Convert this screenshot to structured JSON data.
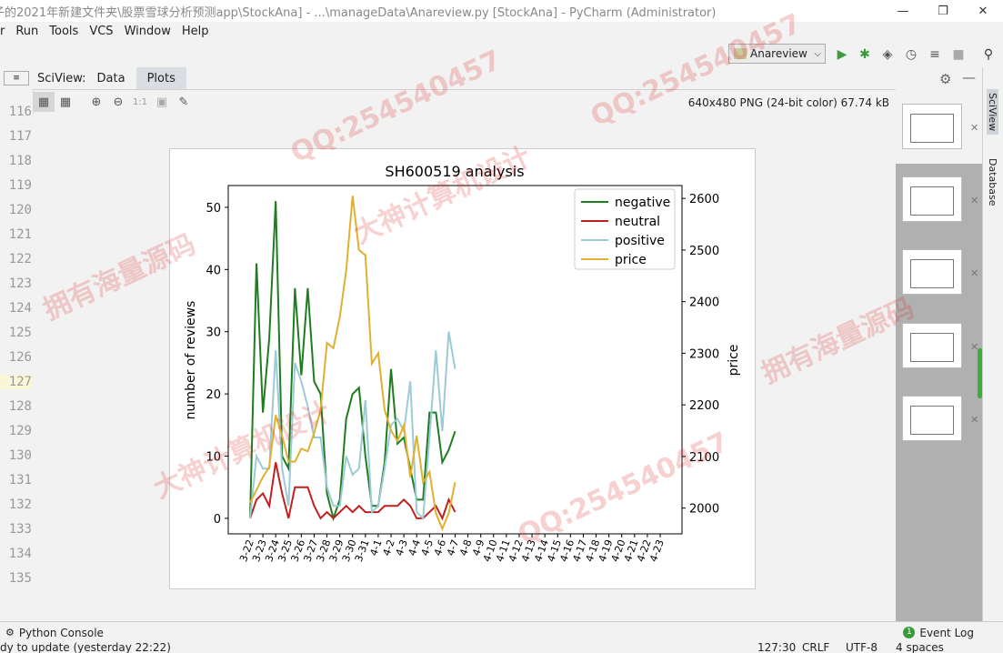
{
  "window": {
    "title": "子的2021年新建文件夹\\股票雪球分析预测app\\StockAna] - ...\\manageData\\Anareview.py [StockAna] - PyCharm (Administrator)",
    "minimize": "—",
    "restore": "❐",
    "close": "✕"
  },
  "menu": [
    "r",
    "Run",
    "Tools",
    "VCS",
    "Window",
    "Help"
  ],
  "toolbar": {
    "run_config": "Anareview"
  },
  "sciview": {
    "label": "SciView:",
    "tabs": [
      "Data",
      "Plots"
    ],
    "active_tab": "Plots",
    "image_info": "640x480 PNG (24-bit color) 67.74 kB",
    "zoom_label": "1:1"
  },
  "line_numbers": [
    "116",
    "117",
    "118",
    "119",
    "120",
    "121",
    "122",
    "123",
    "124",
    "125",
    "126",
    "127",
    "128",
    "129",
    "130",
    "131",
    "132",
    "133",
    "134",
    "135"
  ],
  "right_tabs": [
    "SciView",
    "Database"
  ],
  "bottom": {
    "python_console": "Python Console",
    "event_log": "Event Log",
    "event_count": "1"
  },
  "status": {
    "left": "dy to update (yesterday 22:22)",
    "position": "127:30",
    "line_sep": "CRLF",
    "encoding": "UTF-8",
    "indent": "4 spaces"
  },
  "watermarks": [
    "QQ:254540457",
    "拥有海量源码",
    "大神计算机设计"
  ],
  "chart_data": {
    "type": "line",
    "title": "SH600519 analysis",
    "ylabel": "number of reviews",
    "y2label": "price",
    "ylim": [
      -2.5,
      53.5
    ],
    "y2lim": [
      1950,
      2625
    ],
    "yticks": [
      0,
      10,
      20,
      30,
      40,
      50
    ],
    "y2ticks": [
      2000,
      2100,
      2200,
      2300,
      2400,
      2500,
      2600
    ],
    "categories": [
      "3-22",
      "3-23",
      "3-24",
      "3-25",
      "3-26",
      "3-27",
      "3-28",
      "3-29",
      "3-30",
      "3-31",
      "4-1",
      "4-2",
      "4-3",
      "4-4",
      "4-5",
      "4-6",
      "4-7",
      "4-8",
      "4-9",
      "4-10",
      "4-11",
      "4-12",
      "4-13",
      "4-14",
      "4-15",
      "4-16",
      "4-17",
      "4-18",
      "4-19",
      "4-20",
      "4-21",
      "4-22",
      "4-23"
    ],
    "point_index_x": [
      0,
      0.5,
      1,
      1.5,
      2,
      2.5,
      3,
      3.5,
      4,
      4.5,
      5,
      5.5,
      6,
      6.5,
      7,
      7.5,
      8,
      8.5,
      9,
      9.5,
      10,
      10.5,
      11,
      11.5,
      12,
      12.5,
      13,
      13.5,
      14,
      14.5,
      15,
      15.5,
      16,
      16.5,
      17,
      17.5,
      18,
      18.5,
      19,
      19.5,
      20,
      20.5,
      21,
      21.5,
      22,
      22.5,
      23,
      23.5,
      24,
      24.5,
      25,
      25.5,
      26,
      26.5,
      27,
      27.5,
      28,
      28.5,
      29,
      29.5,
      30,
      30.5,
      31,
      31.5,
      32
    ],
    "legend_position": "top-right",
    "series": [
      {
        "name": "negative",
        "color": "#1e7d1e",
        "axis": "left",
        "values": [
          0,
          41,
          17,
          29,
          51,
          10,
          8,
          37,
          23,
          37,
          22,
          20,
          4,
          0,
          3,
          16,
          20,
          21,
          10,
          2,
          2,
          9,
          24,
          12,
          13,
          8,
          3,
          3,
          17,
          17,
          9,
          11,
          14
        ]
      },
      {
        "name": "neutral",
        "color": "#c02020",
        "axis": "left",
        "values": [
          0,
          3,
          4,
          2,
          9,
          4,
          0,
          5,
          5,
          5,
          2,
          0,
          1,
          0,
          1,
          2,
          1,
          2,
          1,
          1,
          1,
          2,
          2,
          2,
          3,
          2,
          0,
          0,
          1,
          2,
          0,
          3,
          1
        ]
      },
      {
        "name": "positive",
        "color": "#9ccbd6",
        "axis": "left",
        "values": [
          0,
          10,
          8,
          8,
          27,
          8,
          2,
          25,
          22,
          18,
          13,
          13,
          5,
          2,
          2,
          10,
          7,
          8,
          19,
          1,
          2,
          8,
          15,
          16,
          14,
          22,
          1,
          0,
          13,
          27,
          14,
          30,
          24
        ]
      },
      {
        "name": "price",
        "color": "#e0b030",
        "axis": "right",
        "values": [
          2010,
          2035,
          2060,
          2080,
          2180,
          2140,
          2090,
          2090,
          2115,
          2110,
          2145,
          2190,
          2320,
          2310,
          2370,
          2460,
          2605,
          2500,
          2490,
          2280,
          2300,
          2190,
          2150,
          2130,
          2160,
          2060,
          2140,
          2050,
          2070,
          1990,
          1960,
          1990,
          2050
        ]
      }
    ]
  }
}
